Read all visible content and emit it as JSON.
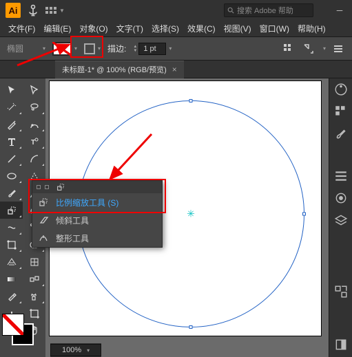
{
  "app": {
    "logo_text": "Ai"
  },
  "search": {
    "placeholder": "搜索 Adobe 帮助"
  },
  "menu": {
    "file": "文件(F)",
    "edit": "编辑(E)",
    "object": "对象(O)",
    "type": "文字(T)",
    "select": "选择(S)",
    "effect": "效果(C)",
    "view": "视图(V)",
    "window": "窗口(W)",
    "help": "帮助(H)"
  },
  "ctrl": {
    "shape": "椭圆",
    "stroke_label": "描边:",
    "stroke_val": "1 pt"
  },
  "tab": {
    "title": "未标题-1* @ 100% (RGB/预览)"
  },
  "flyout": {
    "scale": "比例缩放工具  (S)",
    "shear": "倾斜工具",
    "reshape": "整形工具"
  },
  "status": {
    "zoom": "100%"
  }
}
